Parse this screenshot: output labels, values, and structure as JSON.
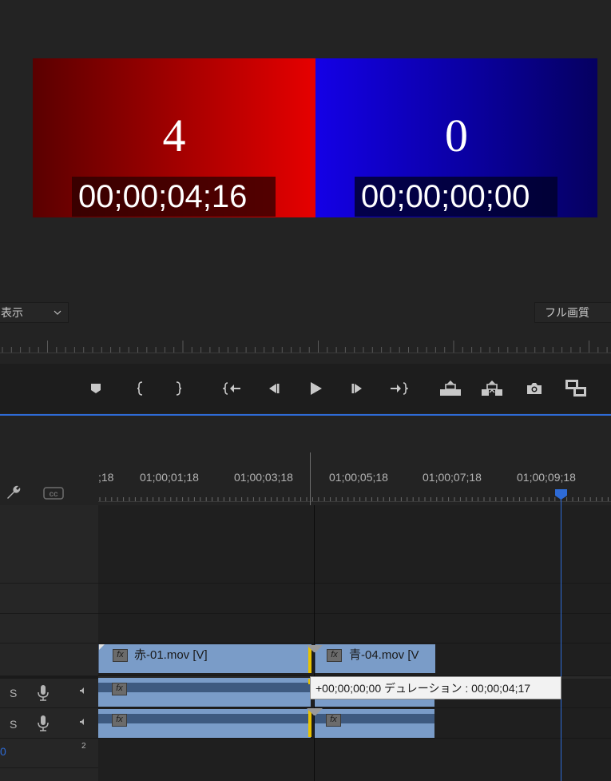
{
  "monitor": {
    "left_number": "4",
    "right_number": "0",
    "left_timecode": "00;00;04;16",
    "right_timecode": "00;00;00;00",
    "view_dropdown": "表示",
    "quality_dropdown": "フル画質"
  },
  "transport": {
    "buttons": [
      "add-marker",
      "mark-in",
      "mark-out",
      "go-to-in",
      "step-back",
      "play",
      "step-forward",
      "go-to-out",
      "lift",
      "extract",
      "export-frame",
      "compare-view"
    ]
  },
  "timeline": {
    "ruler_labels": [
      ";18",
      "01;00;01;18",
      "01;00;03;18",
      "01;00;05;18",
      "01;00;07;18",
      "01;00;09;18"
    ],
    "clips": {
      "video_left": "赤-01.mov [V]",
      "video_right": "青-04.mov [V",
      "fx": "fx"
    },
    "track_s1": "S",
    "track_s2": "S",
    "track_value": "0",
    "track_sup": "2",
    "tooltip": "+00;00;00;00 デュレーション : 00;00;04;17"
  },
  "colors": {
    "accent": "#2e6bd6",
    "clip": "#7a9cc8",
    "red": "#e60000",
    "blue": "#1400e6"
  }
}
